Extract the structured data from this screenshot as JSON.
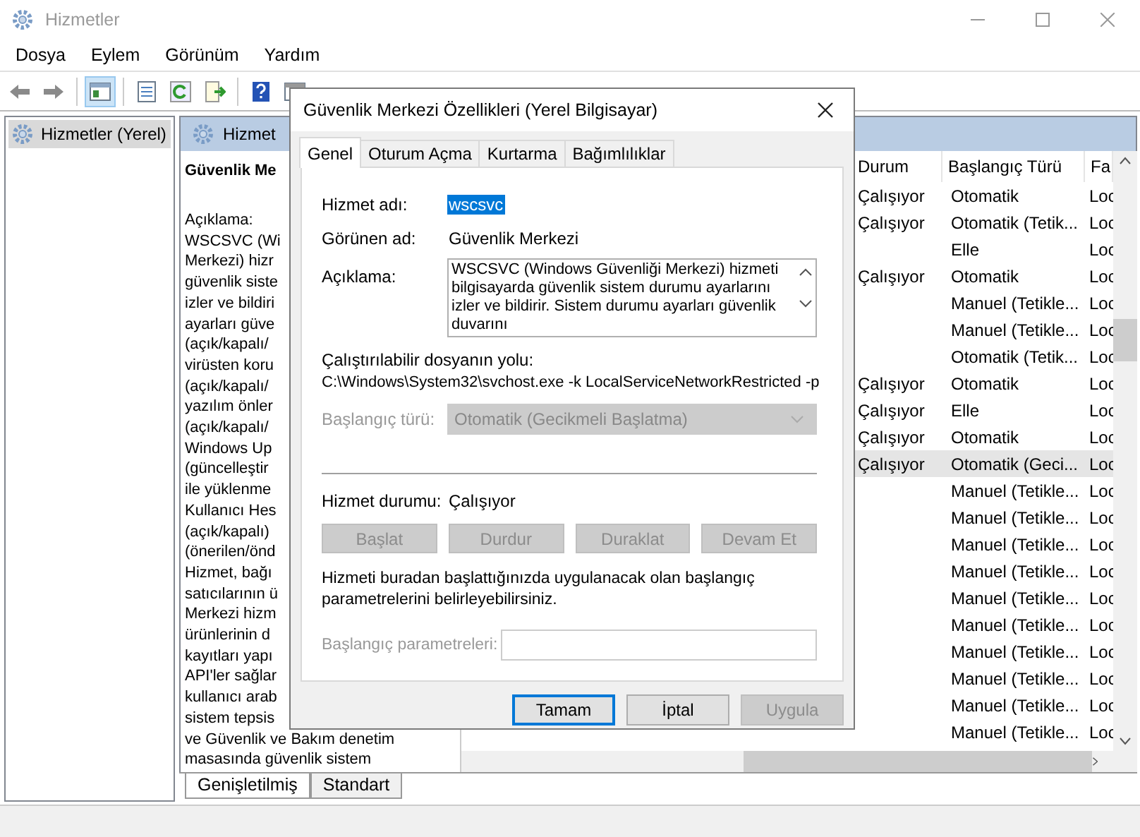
{
  "window": {
    "title": "Hizmetler"
  },
  "menu": [
    "Dosya",
    "Eylem",
    "Görünüm",
    "Yardım"
  ],
  "toolbar": [
    {
      "kind": "back",
      "pressed": false
    },
    {
      "kind": "forward",
      "pressed": false
    },
    {
      "kind": "tree",
      "pressed": true
    },
    {
      "kind": "properties",
      "pressed": false
    },
    {
      "kind": "refresh",
      "pressed": false
    },
    {
      "kind": "export",
      "pressed": false
    },
    {
      "kind": "help",
      "pressed": false
    },
    {
      "kind": "console",
      "pressed": false
    }
  ],
  "tree": {
    "items": [
      {
        "label": "Hizmetler (Yerel)",
        "selected": true
      }
    ]
  },
  "pane_header": "Hizmet",
  "details": {
    "title": "Güvenlik Me",
    "label": "Açıklama:",
    "lines": [
      "WSCSVC (Wi",
      "Merkezi) hizr",
      "güvenlik siste",
      "izler ve bildiri",
      "ayarları güve",
      "(açık/kapalı/",
      "virüsten koru",
      "(açık/kapalı/",
      "yazılım önler",
      "(açık/kapalı/",
      "Windows Up",
      "(güncelleştir",
      "ile yüklenme",
      "Kullanıcı Hes",
      "(açık/kapalı)",
      "(önerilen/önd",
      "Hizmet, bağı",
      "satıcılarının ü",
      "Merkezi hizm",
      "ürünlerinin d",
      "kayıtları yapı",
      "API'ler sağlar",
      "kullanıcı arab",
      "sistem tepsis",
      "ve Güvenlik ve Bakım denetim",
      "masasında güvenlik sistem"
    ]
  },
  "services": {
    "columns": [
      "Durum",
      "Başlangıç Türü",
      "Fa"
    ],
    "rows": [
      {
        "status": "Çalışıyor",
        "startup": "Otomatik",
        "logon": "Loc",
        "selected": false
      },
      {
        "status": "Çalışıyor",
        "startup": "Otomatik (Tetik...",
        "logon": "Loc",
        "selected": false
      },
      {
        "startup": "Elle",
        "logon": "Loc",
        "selected": false
      },
      {
        "status": "Çalışıyor",
        "startup": "Otomatik",
        "logon": "Loc",
        "selected": false
      },
      {
        "startup": "Manuel (Tetikle...",
        "logon": "Loc",
        "selected": false
      },
      {
        "startup": "Manuel (Tetikle...",
        "logon": "Loc",
        "selected": false
      },
      {
        "startup": "Otomatik (Tetik...",
        "logon": "Loc",
        "selected": false
      },
      {
        "status": "Çalışıyor",
        "startup": "Otomatik",
        "logon": "Loc",
        "selected": false
      },
      {
        "status": "Çalışıyor",
        "startup": "Elle",
        "logon": "Loc",
        "selected": false
      },
      {
        "status": "Çalışıyor",
        "startup": "Otomatik",
        "logon": "Loc",
        "selected": false
      },
      {
        "status": "Çalışıyor",
        "startup": "Otomatik (Geci...",
        "logon": "Loc",
        "selected": true
      },
      {
        "startup": "Manuel (Tetikle...",
        "logon": "Loc",
        "selected": false
      },
      {
        "startup": "Manuel (Tetikle...",
        "logon": "Loc",
        "selected": false
      },
      {
        "startup": "Manuel (Tetikle...",
        "logon": "Loc",
        "selected": false
      },
      {
        "startup": "Manuel (Tetikle...",
        "logon": "Loc",
        "selected": false
      },
      {
        "startup": "Manuel (Tetikle...",
        "logon": "Loc",
        "selected": false
      },
      {
        "startup": "Manuel (Tetikle...",
        "logon": "Loc",
        "selected": false
      },
      {
        "startup": "Manuel (Tetikle...",
        "logon": "Loc",
        "selected": false
      },
      {
        "startup": "Manuel (Tetikle...",
        "logon": "Loc",
        "selected": false
      },
      {
        "startup": "Manuel (Tetikle...",
        "logon": "Loc",
        "selected": false
      },
      {
        "startup": "Manuel (Tetikle...",
        "logon": "Loc",
        "selected": false
      }
    ]
  },
  "view_tabs": [
    {
      "label": "Genişletilmiş",
      "selected": true
    },
    {
      "label": "Standart",
      "selected": false
    }
  ],
  "dialog": {
    "title": "Güvenlik Merkezi Özellikleri (Yerel Bilgisayar)",
    "tabs": [
      {
        "label": "Genel",
        "selected": true
      },
      {
        "label": "Oturum Açma",
        "selected": false
      },
      {
        "label": "Kurtarma",
        "selected": false
      },
      {
        "label": "Bağımlılıklar",
        "selected": false
      }
    ],
    "service_name": {
      "label": "Hizmet adı:",
      "value": "wscsvc",
      "selected": true
    },
    "display_name": {
      "label": "Görünen ad:",
      "value": "Güvenlik Merkezi"
    },
    "description": {
      "label": "Açıklama:",
      "value": "WSCSVC (Windows Güvenliği Merkezi) hizmeti bilgisayarda güvenlik sistem durumu ayarlarını izler ve bildirir. Sistem durumu ayarları güvenlik duvarını"
    },
    "path": {
      "label": "Çalıştırılabilir dosyanın yolu:",
      "value": "C:\\Windows\\System32\\svchost.exe -k LocalServiceNetworkRestricted -p"
    },
    "startup_type": {
      "label": "Başlangıç türü:",
      "value": "Otomatik (Gecikmeli Başlatma)",
      "disabled": true
    },
    "status": {
      "label": "Hizmet durumu:",
      "value": "Çalışıyor"
    },
    "control_buttons": [
      {
        "label": "Başlat",
        "disabled": true
      },
      {
        "label": "Durdur",
        "disabled": true
      },
      {
        "label": "Duraklat",
        "disabled": true
      },
      {
        "label": "Devam Et",
        "disabled": true
      }
    ],
    "hint": "Hizmeti buradan başlattığınızda uygulanacak olan başlangıç parametrelerini belirleyebilirsiniz.",
    "parameters": {
      "label": "Başlangıç parametreleri:",
      "disabled": true
    },
    "buttons": [
      {
        "label": "Tamam",
        "default": true,
        "disabled": false
      },
      {
        "label": "İptal",
        "default": false,
        "disabled": false
      },
      {
        "label": "Uygula",
        "default": false,
        "disabled": true
      }
    ]
  }
}
